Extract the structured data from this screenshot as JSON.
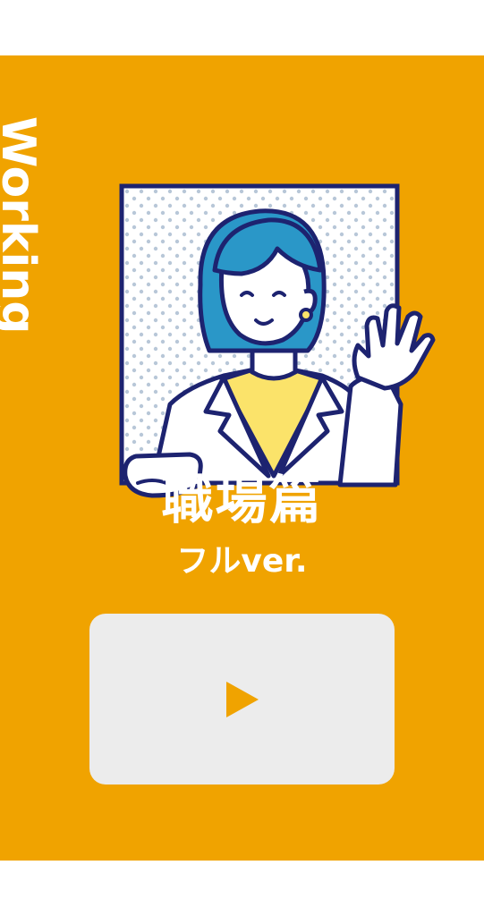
{
  "side_label": "Working",
  "title": "職場篇",
  "subtitle": "フルver.",
  "colors": {
    "background": "#f0a300",
    "page": "#ffffff",
    "player": "#ececec",
    "accent": "#f0a300",
    "hair": "#2a97c8",
    "outline": "#1d2370",
    "shirt": "#fbe36a"
  },
  "icons": {
    "play": "play-icon",
    "illustration": "woman-waving-illustration"
  }
}
